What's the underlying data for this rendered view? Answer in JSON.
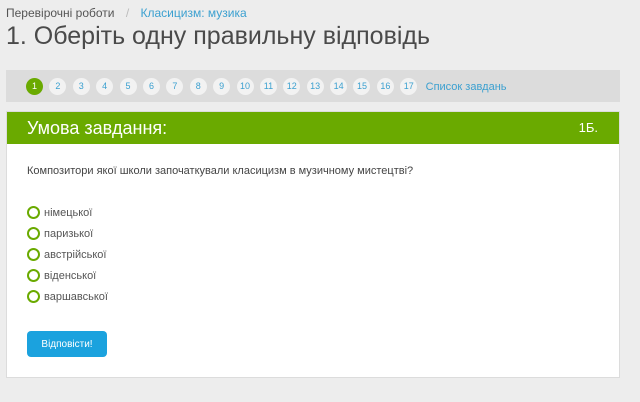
{
  "breadcrumb": {
    "items": [
      "Перевірочні роботи",
      "Класицизм: музика"
    ],
    "separator": "/"
  },
  "page": {
    "title": "1. Оберіть одну правильну відповідь"
  },
  "nav": {
    "numbers": [
      "1",
      "2",
      "3",
      "4",
      "5",
      "6",
      "7",
      "8",
      "9",
      "10",
      "11",
      "12",
      "13",
      "14",
      "15",
      "16",
      "17"
    ],
    "active": "1",
    "tasks_link": "Список завдань"
  },
  "task": {
    "header_label": "Умова завдання:",
    "score": "1Б.",
    "question": "Композитори якої школи започаткували класицизм в музичному мистецтві?",
    "options": [
      "німецької",
      "паризької",
      "австрійської",
      "віденської",
      "варшавської"
    ],
    "submit_label": "Відповісти!"
  },
  "colors": {
    "accent_green": "#6aaa00",
    "link_blue": "#3ba0d0",
    "button_blue": "#1ba2de"
  }
}
